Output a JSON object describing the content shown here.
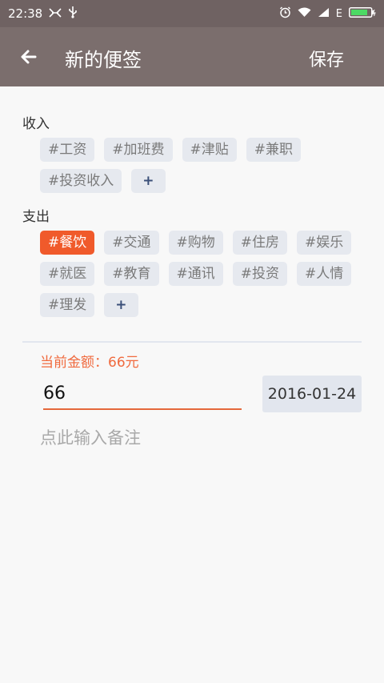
{
  "statusbar": {
    "time": "22:38",
    "icons_left": [
      "notification-icon",
      "usb-icon"
    ],
    "icons_right": [
      "alarm-icon",
      "wifi-icon",
      "signal-icon",
      "battery-icon"
    ],
    "network": "E"
  },
  "header": {
    "title": "新的便签",
    "save_label": "保存"
  },
  "income": {
    "label": "收入",
    "tags": [
      "#工资",
      "#加班费",
      "#津贴",
      "#兼职",
      "#投资收入"
    ],
    "add_label": "+"
  },
  "expense": {
    "label": "支出",
    "tags": [
      "#餐饮",
      "#交通",
      "#购物",
      "#住房",
      "#娱乐",
      "#就医",
      "#教育",
      "#通讯",
      "#投资",
      "#人情",
      "#理发"
    ],
    "selected": "#餐饮",
    "add_label": "+"
  },
  "amount": {
    "label": "当前金额：66元",
    "value": "66"
  },
  "date": "2016-01-24",
  "note": {
    "placeholder": "点此输入备注",
    "value": ""
  },
  "colors": {
    "appbar": "#7b6e6d",
    "accent": "#f05a2b",
    "tag_bg": "#e6e9ef"
  }
}
